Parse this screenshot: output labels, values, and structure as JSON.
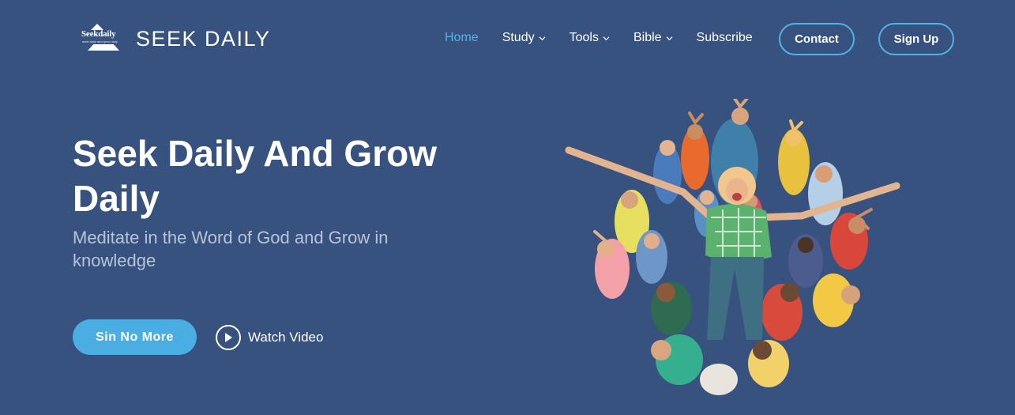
{
  "brand": {
    "logo_text": "Seekdaily",
    "logo_tagline": "seek daily and grow daily",
    "name": "SEEK DAILY"
  },
  "nav": {
    "items": [
      {
        "label": "Home",
        "active": true,
        "dropdown": false
      },
      {
        "label": "Study",
        "active": false,
        "dropdown": true
      },
      {
        "label": "Tools",
        "active": false,
        "dropdown": true
      },
      {
        "label": "Bible",
        "active": false,
        "dropdown": true
      },
      {
        "label": "Subscribe",
        "active": false,
        "dropdown": false
      }
    ],
    "contact_label": "Contact",
    "signup_label": "Sign Up"
  },
  "hero": {
    "title": "Seek Daily And Grow Daily",
    "subtitle": "Meditate in the Word of God and Grow in knowledge",
    "cta_label": "Sin No More",
    "watch_label": "Watch Video",
    "image": "crowd-of-people-jumping-photo"
  },
  "colors": {
    "background": "#37527f",
    "accent": "#4fb3e8",
    "cta": "#4aaee3",
    "subtitle": "#b9c4d8"
  }
}
